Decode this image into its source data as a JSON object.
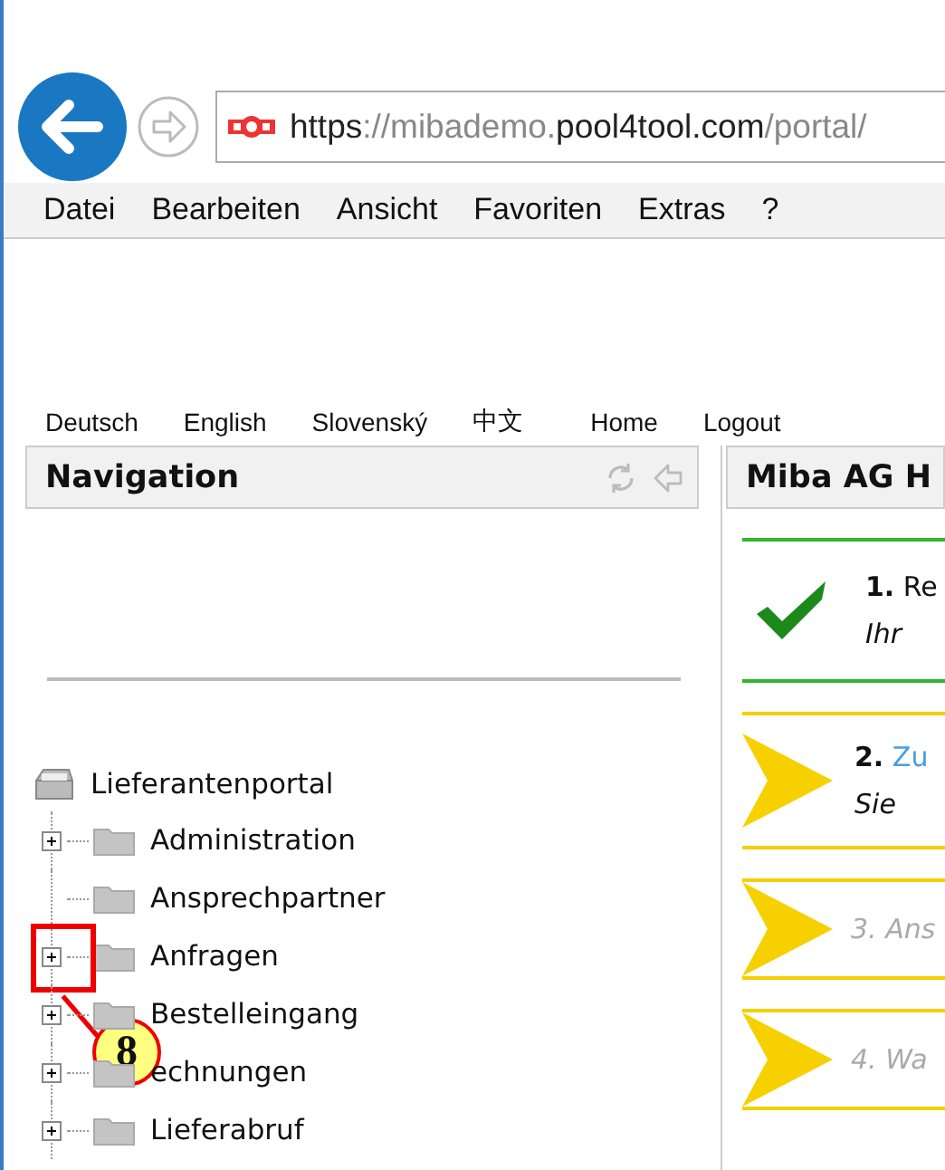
{
  "browser": {
    "url_parts": [
      {
        "text": "https",
        "strong": true
      },
      {
        "text": "://mibademo.",
        "strong": false
      },
      {
        "text": "pool4tool.com",
        "strong": true
      },
      {
        "text": "/portal/",
        "strong": false
      }
    ],
    "menu": [
      "Datei",
      "Bearbeiten",
      "Ansicht",
      "Favoriten",
      "Extras",
      "?"
    ]
  },
  "languages": [
    "Deutsch",
    "English",
    "Slovenský",
    "中文"
  ],
  "top_links": [
    "Home",
    "Logout"
  ],
  "navigation": {
    "title": "Navigation",
    "root": "Lieferantenportal",
    "children": [
      {
        "label": "Administration",
        "expandable": true,
        "highlighted": false
      },
      {
        "label": "Ansprechpartner",
        "expandable": false,
        "highlighted": false
      },
      {
        "label": "Anfragen",
        "expandable": true,
        "highlighted": true
      },
      {
        "label": "Bestelleingang",
        "expandable": true,
        "highlighted": false
      },
      {
        "label": "echnungen",
        "expandable": true,
        "highlighted": false
      },
      {
        "label": "Lieferabruf",
        "expandable": true,
        "highlighted": false
      }
    ]
  },
  "callout": {
    "number": "8"
  },
  "main": {
    "title": "Miba AG H",
    "steps": [
      {
        "kind": "done",
        "number": "1.",
        "title": "Re",
        "subtitle": "Ihr"
      },
      {
        "kind": "current",
        "number": "2.",
        "title": "Zu",
        "subtitle": "Sie"
      },
      {
        "kind": "pending",
        "number": "3.",
        "title": "Ans"
      },
      {
        "kind": "pending",
        "number": "4.",
        "title": "Wa"
      }
    ]
  }
}
